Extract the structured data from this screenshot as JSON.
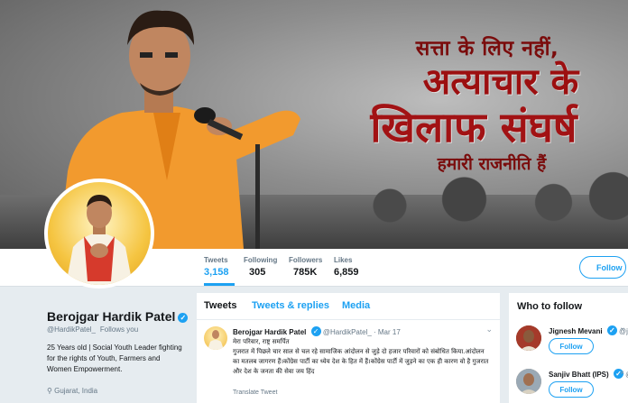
{
  "banner": {
    "slogan_line1": "सत्ता के लिए नहीं,",
    "slogan_line2": "अत्याचार के",
    "slogan_line3": "खिलाफ संघर्ष",
    "slogan_line4": "हमारी राजनीति हैं"
  },
  "nav": {
    "stats": [
      {
        "label": "Tweets",
        "value": "3,158"
      },
      {
        "label": "Following",
        "value": "305"
      },
      {
        "label": "Followers",
        "value": "785K"
      },
      {
        "label": "Likes",
        "value": "6,859"
      }
    ],
    "follow_label": "Follow"
  },
  "profile": {
    "name": "Berojgar Hardik Patel",
    "verified_glyph": "✓",
    "handle": "@HardikPatel_",
    "follows_you": "Follows you",
    "bio": "25 Years old | Social Youth Leader fighting for the rights of Youth, Farmers and Women Empowerment.",
    "location": "Gujarat, India"
  },
  "timeline": {
    "tabs": [
      "Tweets",
      "Tweets & replies",
      "Media"
    ],
    "tweet": {
      "name": "Berojgar Hardik Patel",
      "meta": "@HardikPatel_ · Mar 17",
      "text": "मेरा परिवार, राष्ट्र समर्पित\nगुजरात में पिछले चार साल से चल रहे सामाजिक आंदोलन से जुड़े दो हजार परिवारों को संबोधित किया.आंदोलन का मतलब जागरण हैं।कोंग्रेस पार्टी का ध्येय देश के हित में हैं।कोंग्रेस पार्टी में जुड़ने का एक ही कारण वो है गुजरात और देश के जनता की सेवा जय हिंद",
      "translate": "Translate Tweet",
      "chevron": "⌄"
    }
  },
  "wtf": {
    "title": "Who to follow",
    "items": [
      {
        "name": "Jignesh Mevani",
        "handle": "@jign",
        "follow": "Follow",
        "close": "×"
      },
      {
        "name": "Sanjiv Bhatt (IPS)",
        "handle": "@s",
        "follow": "Follow",
        "close": "×"
      }
    ]
  },
  "colors": {
    "accent": "#1da1f2",
    "banner_red": "#9c0f10",
    "kurta_orange": "#f29a2e"
  }
}
